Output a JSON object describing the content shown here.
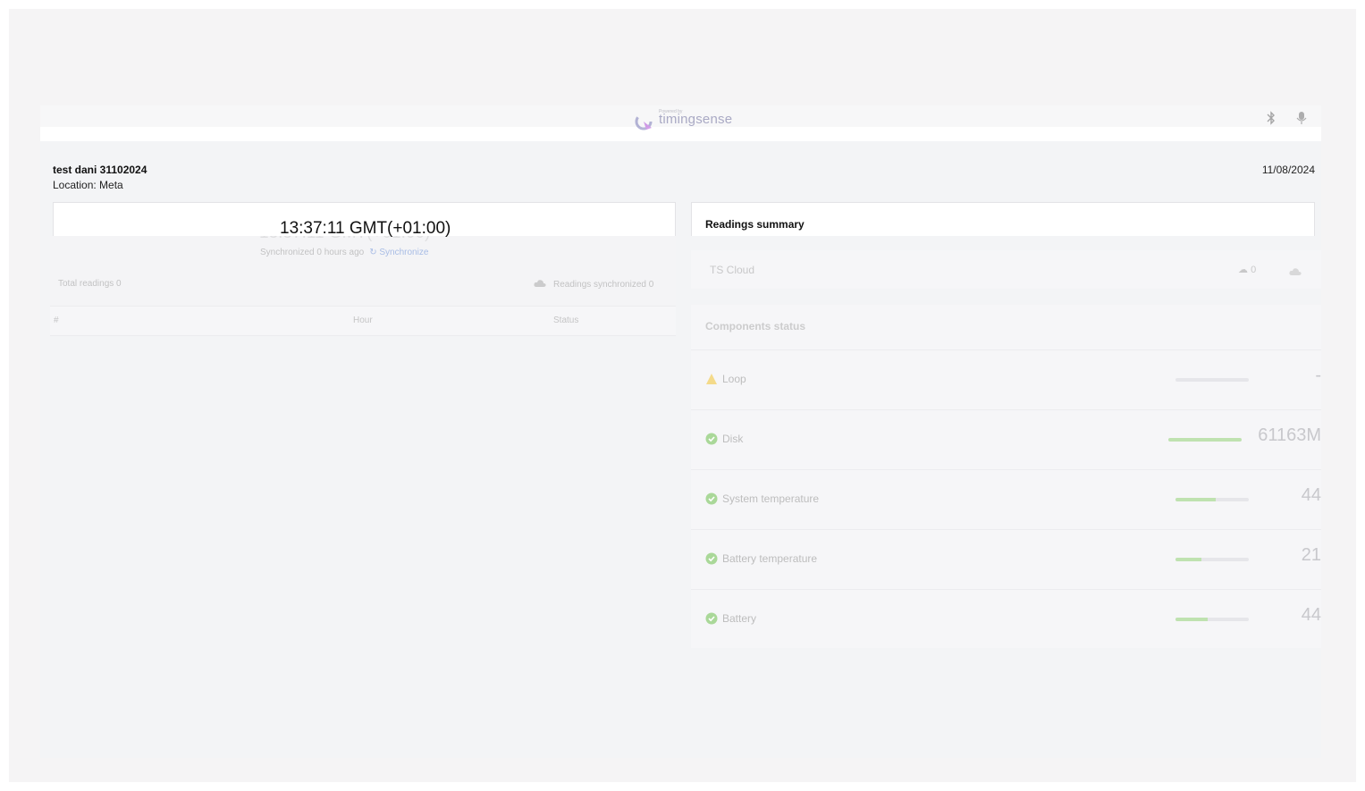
{
  "brand": {
    "powered_by": "Powered by",
    "name": "timingsense"
  },
  "device": {
    "name": "test dani 31102024",
    "location": "Location: Meta",
    "date": "11/08/2024"
  },
  "left_panel": {
    "clock": "13:37:11 GMT(+01:00)",
    "clock_ghost": "13:37:11 GMT(+01:00)",
    "sync_status": "Synchronized 0 hours ago",
    "sync_action": "Synchronize",
    "total_readings": "Total readings 0",
    "readings_synchronized": "Readings synchronized 0",
    "table_columns": [
      "#",
      "Hour",
      "Status"
    ]
  },
  "readings_summary": {
    "title": "Readings summary",
    "cloud_label": "TS Cloud",
    "cloud_count": "0"
  },
  "components": {
    "title": "Components status",
    "items": [
      {
        "label": "Loop",
        "status": "warning",
        "level": 0.0,
        "value": "-"
      },
      {
        "label": "Disk",
        "status": "ok",
        "level": 1.0,
        "value": "61163M"
      },
      {
        "label": "System temperature",
        "status": "ok",
        "level": 0.55,
        "value": "44"
      },
      {
        "label": "Battery temperature",
        "status": "ok",
        "level": 0.35,
        "value": "21"
      },
      {
        "label": "Battery",
        "status": "ok",
        "level": 0.44,
        "value": "44"
      }
    ]
  },
  "colors": {
    "ok": "#6cc04a",
    "warning": "#f2b705",
    "link": "#6a8fd8"
  }
}
